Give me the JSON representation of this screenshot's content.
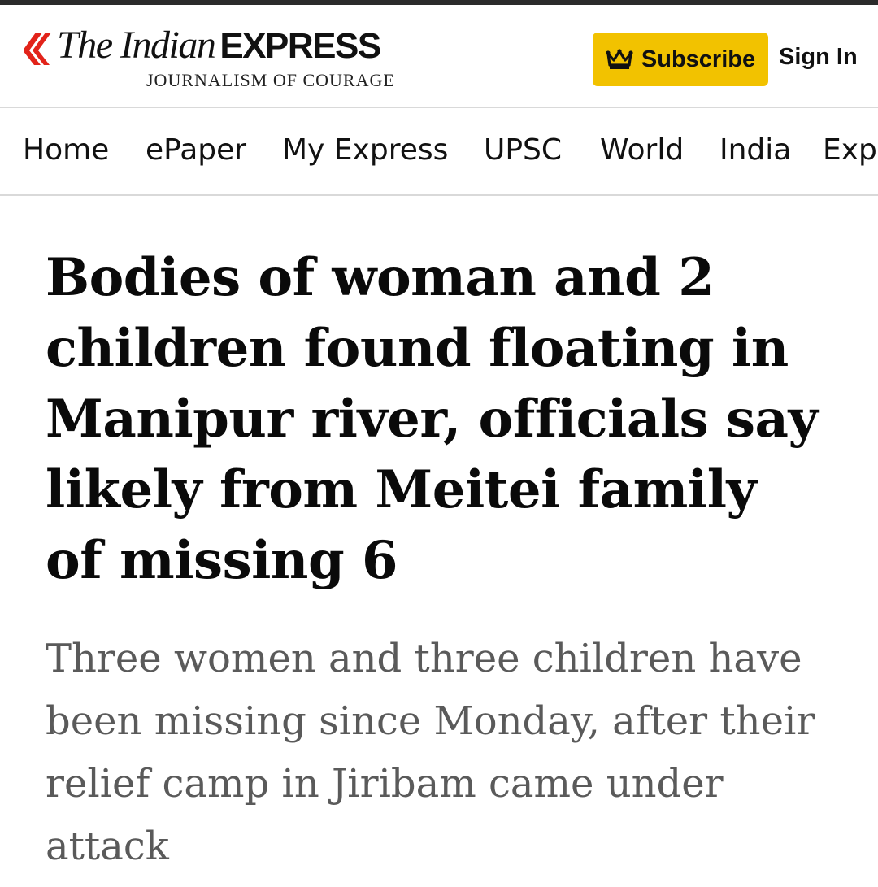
{
  "header": {
    "logo": {
      "name_part1": "The Indian",
      "name_part2": "EXPRESS",
      "tagline": "JOURNALISM OF COURAGE"
    },
    "subscribe_label": "Subscribe",
    "signin_label": "Sign In"
  },
  "nav": {
    "items": [
      {
        "label": "Home"
      },
      {
        "label": "ePaper"
      },
      {
        "label": "My Express"
      },
      {
        "label": "UPSC"
      },
      {
        "label": "World"
      },
      {
        "label": "India"
      },
      {
        "label": "Exp"
      }
    ]
  },
  "article": {
    "headline": "Bodies of woman and 2 children found floating in Manipur river, officials say likely from Meitei family of missing 6",
    "standfirst": "Three women and three children have been missing since Monday, after their relief camp in Jiribam came under attack"
  },
  "colors": {
    "brand_red": "#e2231a",
    "subscribe_yellow": "#f2c200",
    "standfirst_gray": "#5a5a5a"
  },
  "icons": {
    "logo": "indian-express-flame-logo",
    "subscribe": "crown-icon"
  }
}
